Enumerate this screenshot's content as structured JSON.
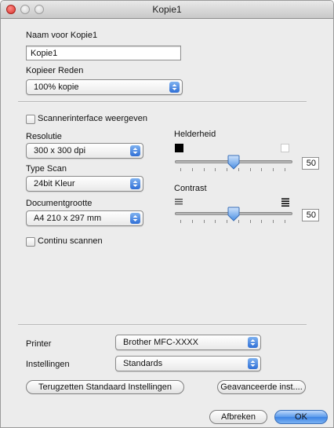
{
  "window": {
    "title": "Kopie1"
  },
  "name_label": "Naam voor Kopie1",
  "name_value": "Kopie1",
  "reason_label": "Kopieer Reden",
  "reason_value": "100% kopie",
  "scanner_interface": {
    "label": "Scannerinterface weergeven",
    "checked": false
  },
  "resolution": {
    "label": "Resolutie",
    "value": "300 x 300 dpi"
  },
  "scan_type": {
    "label": "Type Scan",
    "value": "24bit Kleur"
  },
  "document_size": {
    "label": "Documentgrootte",
    "value": "A4 210 x 297 mm"
  },
  "continuous_scan": {
    "label": "Continu scannen",
    "checked": false
  },
  "brightness": {
    "label": "Helderheid",
    "value": "50",
    "level_percent": 50
  },
  "contrast": {
    "label": "Contrast",
    "value": "50",
    "level_percent": 50
  },
  "printer": {
    "label": "Printer",
    "value": "Brother MFC-XXXX"
  },
  "settings": {
    "label": "Instellingen",
    "value": "Standards"
  },
  "buttons": {
    "reset": "Terugzetten Standaard Instellingen",
    "advanced": "Geavanceerde inst....",
    "cancel": "Afbreken",
    "ok": "OK"
  },
  "colors": {
    "accent": "#3c83e4",
    "close": "#d8322c"
  }
}
